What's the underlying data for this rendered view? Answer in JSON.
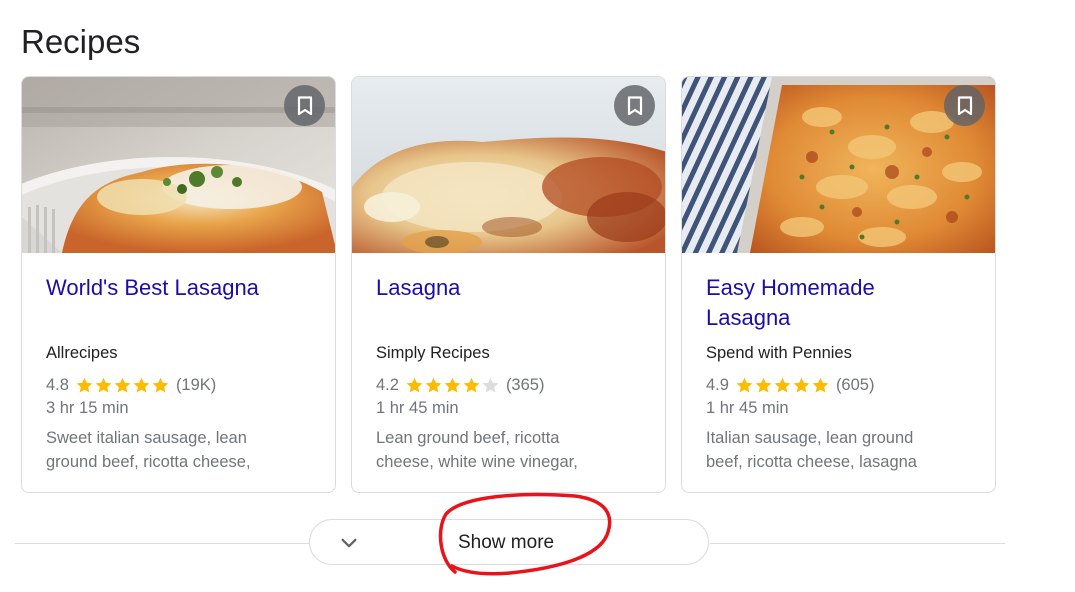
{
  "section": {
    "title": "Recipes"
  },
  "cards": [
    {
      "title": "World's Best Lasagna",
      "source": "Allrecipes",
      "rating": "4.8",
      "stars": 5,
      "reviews": "(19K)",
      "time": "3 hr 15 min",
      "desc_line1": "Sweet italian sausage, lean",
      "desc_line2": "ground beef, ricotta cheese,"
    },
    {
      "title": "Lasagna",
      "source": "Simply Recipes",
      "rating": "4.2",
      "stars": 4,
      "reviews": "(365)",
      "time": "1 hr 45 min",
      "desc_line1": "Lean ground beef, ricotta",
      "desc_line2": "cheese, white wine vinegar,"
    },
    {
      "title_line1": "Easy Homemade",
      "title_line2": "Lasagna",
      "source": "Spend with Pennies",
      "rating": "4.9",
      "stars": 5,
      "reviews": "(605)",
      "time": "1 hr 45 min",
      "desc_line1": "Italian sausage, lean ground",
      "desc_line2": "beef, ricotta cheese, lasagna"
    }
  ],
  "show_more": {
    "label": "Show more"
  },
  "colors": {
    "link": "#1a0dab",
    "star_filled": "#fbbc04",
    "star_empty": "#dadce0",
    "annotation": "#e8141c"
  },
  "icons": {
    "bookmark": "bookmark-icon",
    "chevron": "chevron-down-icon"
  }
}
